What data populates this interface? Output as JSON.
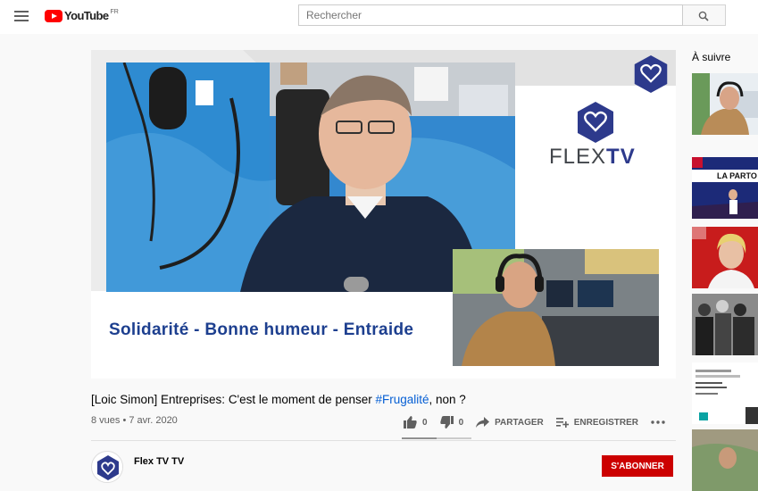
{
  "header": {
    "logo_text": "YouTube",
    "logo_region": "FR",
    "search_placeholder": "Rechercher"
  },
  "player": {
    "slogan": "Solidarité - Bonne humeur - Entraide",
    "brand_flex": "FLEX",
    "brand_tv": "TV"
  },
  "video": {
    "title_main": "[Loic Simon] Entreprises: C'est le moment de penser ",
    "title_hashtag": "#Frugalité",
    "title_end": ", non ?",
    "views_date": "8 vues • 7 avr. 2020",
    "likes": "0",
    "dislikes": "0",
    "share_label": "PARTAGER",
    "save_label": "ENREGISTRER",
    "like_ratio": 0.5
  },
  "channel": {
    "name": "Flex TV TV",
    "subscribe_label": "S'ABONNER"
  },
  "sidebar": {
    "up_next_label": "À suivre",
    "thumb_text_partout": "LA PARTO"
  },
  "colors": {
    "brand_red": "#ff0000",
    "subscribe_red": "#cc0000",
    "link_blue": "#065fd4",
    "flex_blue": "#2d3a8c"
  }
}
